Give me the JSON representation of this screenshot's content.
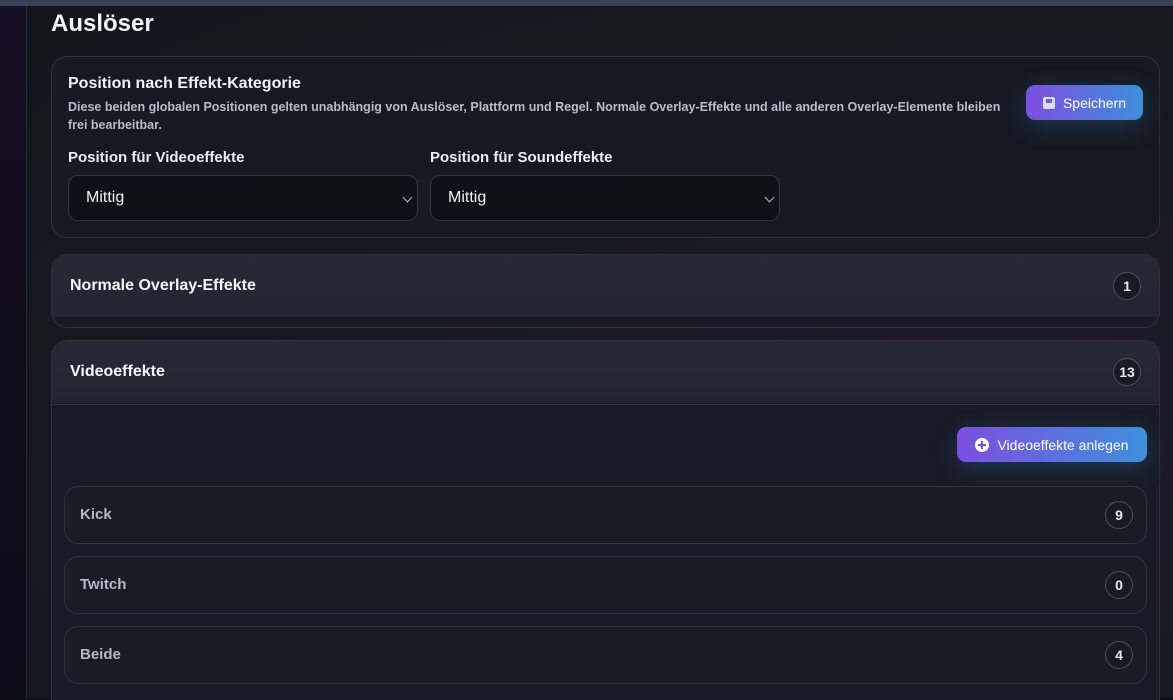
{
  "page": {
    "title": "Auslöser"
  },
  "position_card": {
    "title": "Position nach Effekt-Kategorie",
    "description": "Diese beiden globalen Positionen gelten unabhängig von Auslöser, Plattform und Regel. Normale Overlay-Effekte und alle anderen Overlay-Elemente bleiben frei bearbeitbar.",
    "save_label": "Speichern",
    "video_position_label": "Position für Videoeffekte",
    "video_position_value": "Mittig",
    "sound_position_label": "Position für Soundeffekte",
    "sound_position_value": "Mittig"
  },
  "sections": {
    "overlay": {
      "title": "Normale Overlay-Effekte",
      "count": "1"
    },
    "video": {
      "title": "Videoeffekte",
      "count": "13",
      "add_label": "Videoeffekte anlegen",
      "platforms": [
        {
          "label": "Kick",
          "count": "9"
        },
        {
          "label": "Twitch",
          "count": "0"
        },
        {
          "label": "Beide",
          "count": "4"
        }
      ]
    }
  },
  "icons": {
    "save": "save-icon",
    "add": "plus-circle-icon",
    "dropdown": "chevron-down-icon"
  },
  "colors": {
    "accent_start": "#7c4fe0",
    "accent_end": "#3f8fdc"
  }
}
